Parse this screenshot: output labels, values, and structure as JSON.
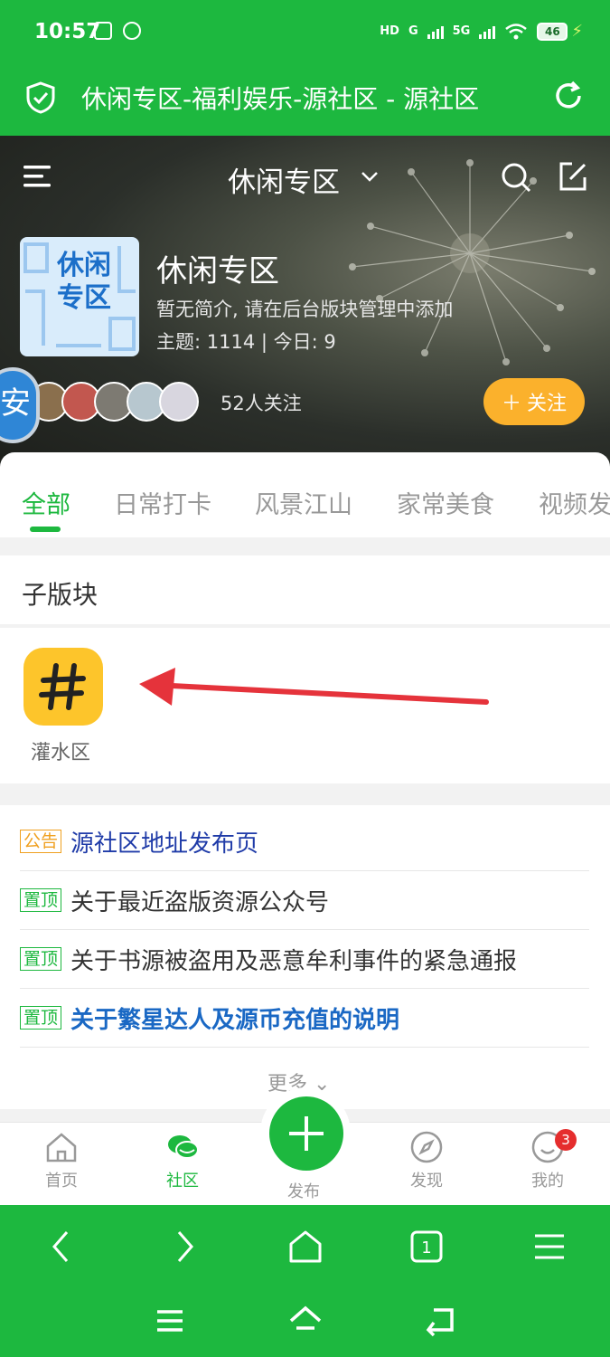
{
  "status_bar": {
    "time": "10:57",
    "battery": "46",
    "hd": "HD",
    "net1": "G",
    "net2": "5G"
  },
  "browser": {
    "page_title": "休闲专区-福利娱乐-源社区 - 源社区"
  },
  "header": {
    "section_title": "休闲专区",
    "forum_logo_text": "休闲专区",
    "forum_name": "休闲专区",
    "description": "暂无简介, 请在后台版块管理中添加",
    "stats": "主题: 1114  |  今日: 9",
    "followers": "52人关注",
    "follow_button": "关注",
    "float_bubble": "安"
  },
  "tabs": [
    "全部",
    "日常打卡",
    "风景江山",
    "家常美食",
    "视频发"
  ],
  "subforums": {
    "heading": "子版块",
    "items": [
      {
        "name": "灌水区",
        "icon": "hashtag-icon"
      }
    ]
  },
  "notices": [
    {
      "tag": "公告",
      "text": "源社区地址发布页"
    },
    {
      "tag": "置顶",
      "text": "关于最近盗版资源公众号"
    },
    {
      "tag": "置顶",
      "text": "关于书源被盗用及恶意牟利事件的紧急通报"
    },
    {
      "tag": "置顶",
      "text": "关于繁星达人及源币充值的说明"
    }
  ],
  "more": "更多",
  "tabbar": {
    "home": "首页",
    "community": "社区",
    "post": "发布",
    "discover": "发现",
    "mine": "我的",
    "mine_badge": "3"
  },
  "colors": {
    "brand_green": "#1db83f",
    "follow_orange": "#fbb12c",
    "arrow_red": "#e5333b"
  }
}
